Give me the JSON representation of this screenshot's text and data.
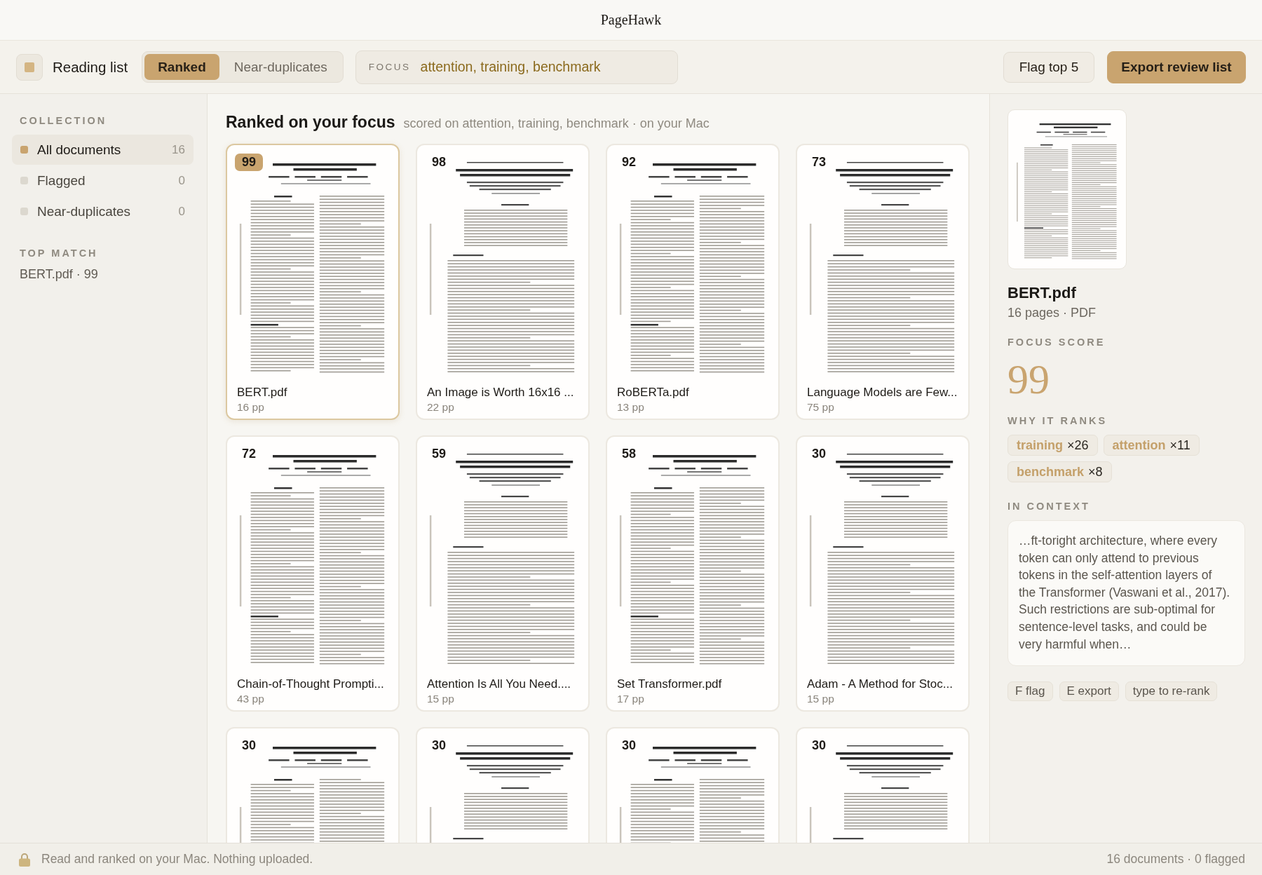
{
  "window": {
    "title": "PageHawk"
  },
  "toolbar": {
    "title": "Reading list",
    "tabs": [
      {
        "label": "Ranked",
        "selected": true
      },
      {
        "label": "Near-duplicates",
        "selected": false
      }
    ],
    "focus": {
      "label": "FOCUS",
      "value": "attention, training, benchmark"
    },
    "buttons": [
      {
        "label": "Flag top 5",
        "kind": "secondary"
      },
      {
        "label": "Export review list",
        "kind": "primary"
      }
    ]
  },
  "sidebar": {
    "heading": "COLLECTION",
    "items": [
      {
        "label": "All documents",
        "count": "16",
        "selected": true
      },
      {
        "label": "Flagged",
        "count": "0",
        "selected": false
      },
      {
        "label": "Near-duplicates",
        "count": "0",
        "selected": false
      }
    ],
    "top_match": {
      "heading": "TOP MATCH",
      "text": "BERT.pdf · 99"
    }
  },
  "main": {
    "heading": "Ranked on your focus",
    "subtitle": "scored on attention, training, benchmark · on your Mac",
    "cards": [
      {
        "score": "99",
        "title": "BERT.pdf",
        "pages": "16 pp",
        "selected": true
      },
      {
        "score": "98",
        "title": "An Image is Worth 16x16 ...",
        "pages": "22 pp",
        "selected": false
      },
      {
        "score": "92",
        "title": "RoBERTa.pdf",
        "pages": "13 pp",
        "selected": false
      },
      {
        "score": "73",
        "title": "Language Models are Few...",
        "pages": "75 pp",
        "selected": false
      },
      {
        "score": "72",
        "title": "Chain-of-Thought Prompti...",
        "pages": "43 pp",
        "selected": false
      },
      {
        "score": "59",
        "title": "Attention Is All You Need....",
        "pages": "15 pp",
        "selected": false
      },
      {
        "score": "58",
        "title": "Set Transformer.pdf",
        "pages": "17 pp",
        "selected": false
      },
      {
        "score": "30",
        "title": "Adam - A Method for Stoc...",
        "pages": "15 pp",
        "selected": false
      },
      {
        "score": "30",
        "selected": false
      },
      {
        "score": "30",
        "selected": false
      },
      {
        "score": "30",
        "selected": false
      },
      {
        "score": "30",
        "selected": false
      }
    ]
  },
  "detail": {
    "name": "BERT.pdf",
    "meta": "16 pages · PDF",
    "score_heading": "FOCUS SCORE",
    "score": "99",
    "reasons_heading": "WHY IT RANKS",
    "terms": [
      {
        "term": "training",
        "count": "×26"
      },
      {
        "term": "attention",
        "count": "×11"
      },
      {
        "term": "benchmark",
        "count": "×8"
      }
    ],
    "context_heading": "IN CONTEXT",
    "context": "…ft-toright architecture, where every token can only attend to previous tokens in the self-attention layers of the Transformer (Vaswani et al., 2017). Such restrictions are sub-optimal for sentence-level tasks, and could be very harmful when…",
    "hints": [
      "F flag",
      "E export",
      "type to re-rank"
    ]
  },
  "status_bar": {
    "left": "Read and ranked on your Mac. Nothing uploaded.",
    "right": "16 documents · 0 flagged"
  }
}
